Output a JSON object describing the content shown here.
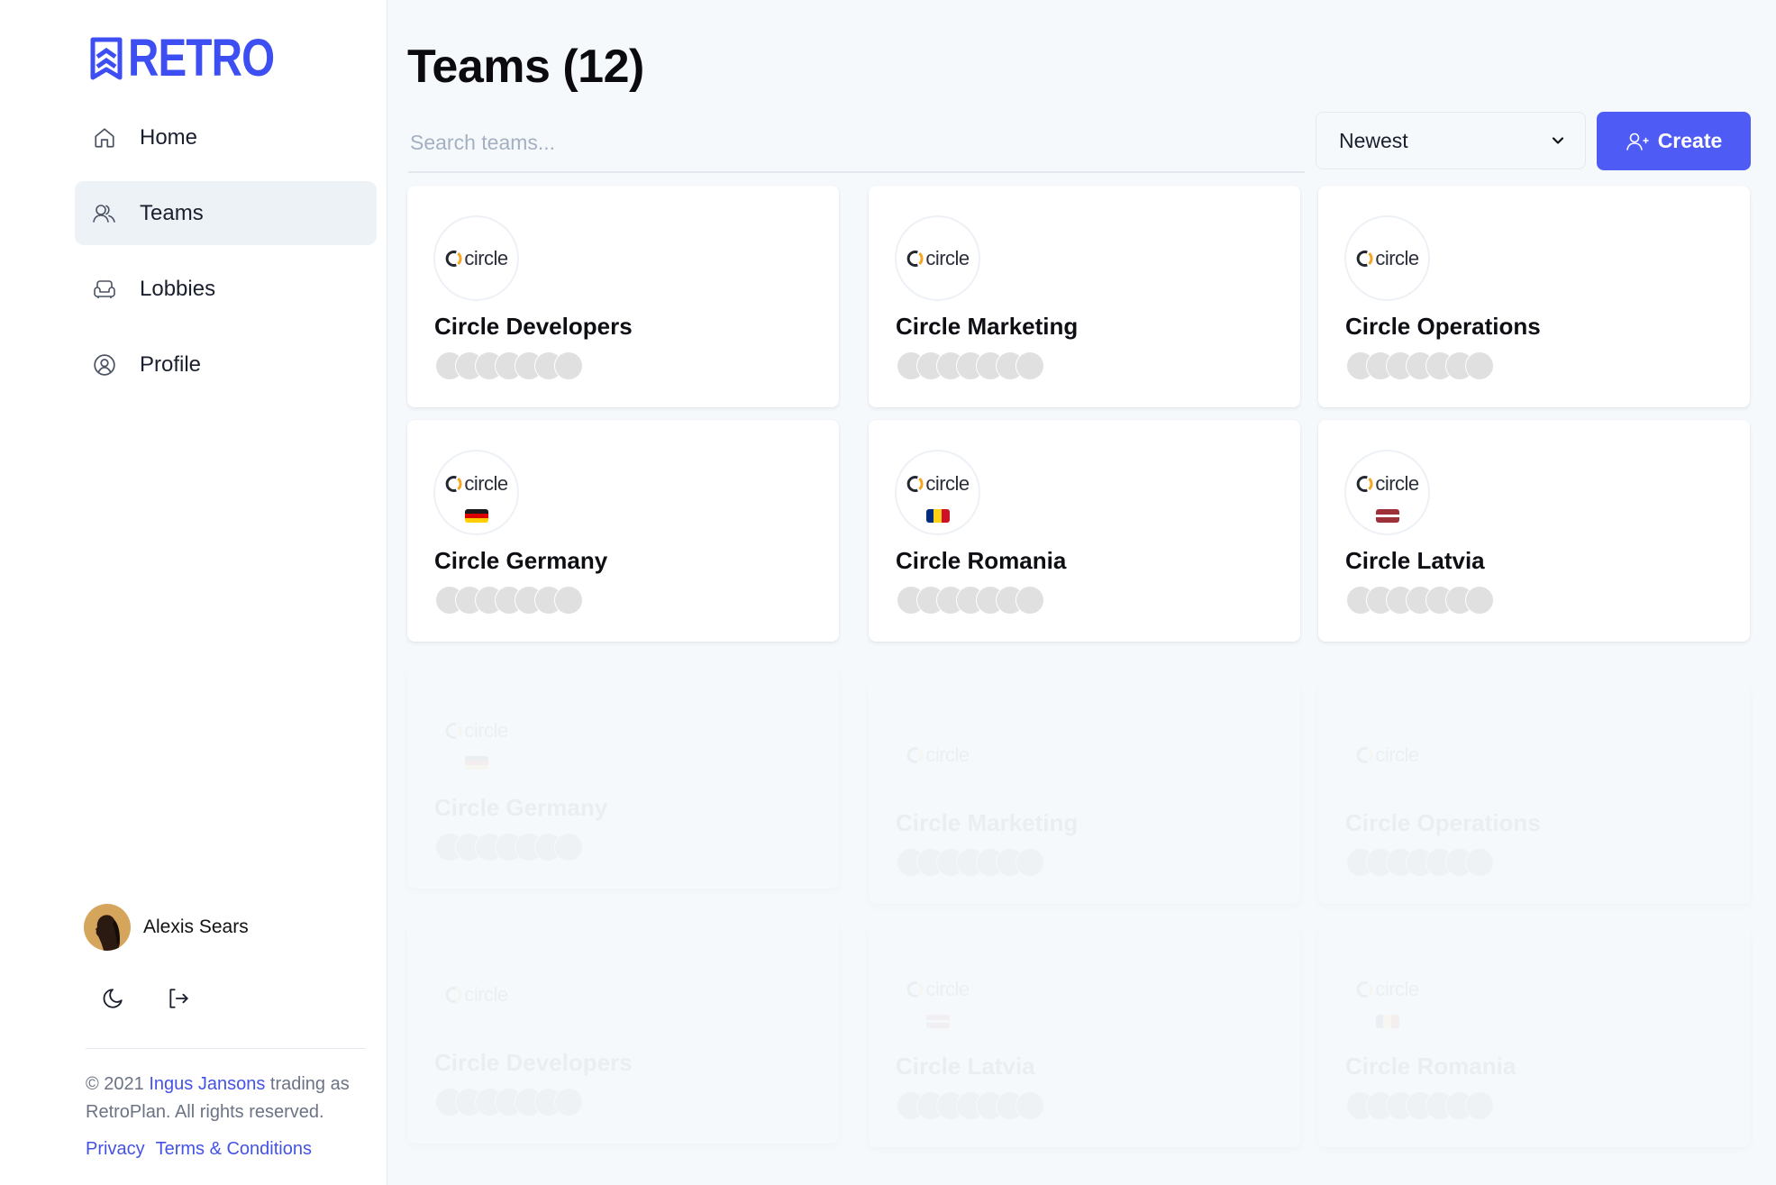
{
  "app": {
    "brand": "RETRO",
    "brand_color": "#3d4ff2",
    "accent_color": "#4f5bf5"
  },
  "sidebar": {
    "items": [
      {
        "label": "Home",
        "icon": "home-icon",
        "active": false
      },
      {
        "label": "Teams",
        "icon": "users-icon",
        "active": true
      },
      {
        "label": "Lobbies",
        "icon": "armchair-icon",
        "active": false
      },
      {
        "label": "Profile",
        "icon": "user-circle-icon",
        "active": false
      }
    ],
    "user": {
      "name": "Alexis Sears"
    },
    "actions": {
      "theme_icon": "moon-icon",
      "logout_icon": "logout-icon"
    },
    "footer": {
      "copyright_prefix": "© 2021 ",
      "author": "Ingus Jansons",
      "copyright_suffix": " trading as RetroPlan. All rights reserved.",
      "privacy": "Privacy",
      "terms": "Terms & Conditions"
    }
  },
  "main": {
    "title": "Teams (12)",
    "search_placeholder": "Search teams...",
    "search_value": "",
    "sort_selected": "Newest",
    "create_label": "Create",
    "logo_text": "circle",
    "teams": [
      {
        "name": "Circle Developers",
        "flag": null,
        "members": 7
      },
      {
        "name": "Circle Marketing",
        "flag": null,
        "members": 7
      },
      {
        "name": "Circle Operations",
        "flag": null,
        "members": 7
      },
      {
        "name": "Circle Germany",
        "flag": "de",
        "members": 7
      },
      {
        "name": "Circle Romania",
        "flag": "ro",
        "members": 7
      },
      {
        "name": "Circle Latvia",
        "flag": "lv",
        "members": 7
      }
    ],
    "faded_teams": [
      {
        "name": "Circle Germany",
        "flag": "de"
      },
      {
        "name": "Circle Marketing",
        "flag": null
      },
      {
        "name": "Circle Operations",
        "flag": null
      },
      {
        "name": "Circle Developers",
        "flag": null
      },
      {
        "name": "Circle Latvia",
        "flag": "lv"
      },
      {
        "name": "Circle Romania",
        "flag": "ro"
      }
    ]
  }
}
